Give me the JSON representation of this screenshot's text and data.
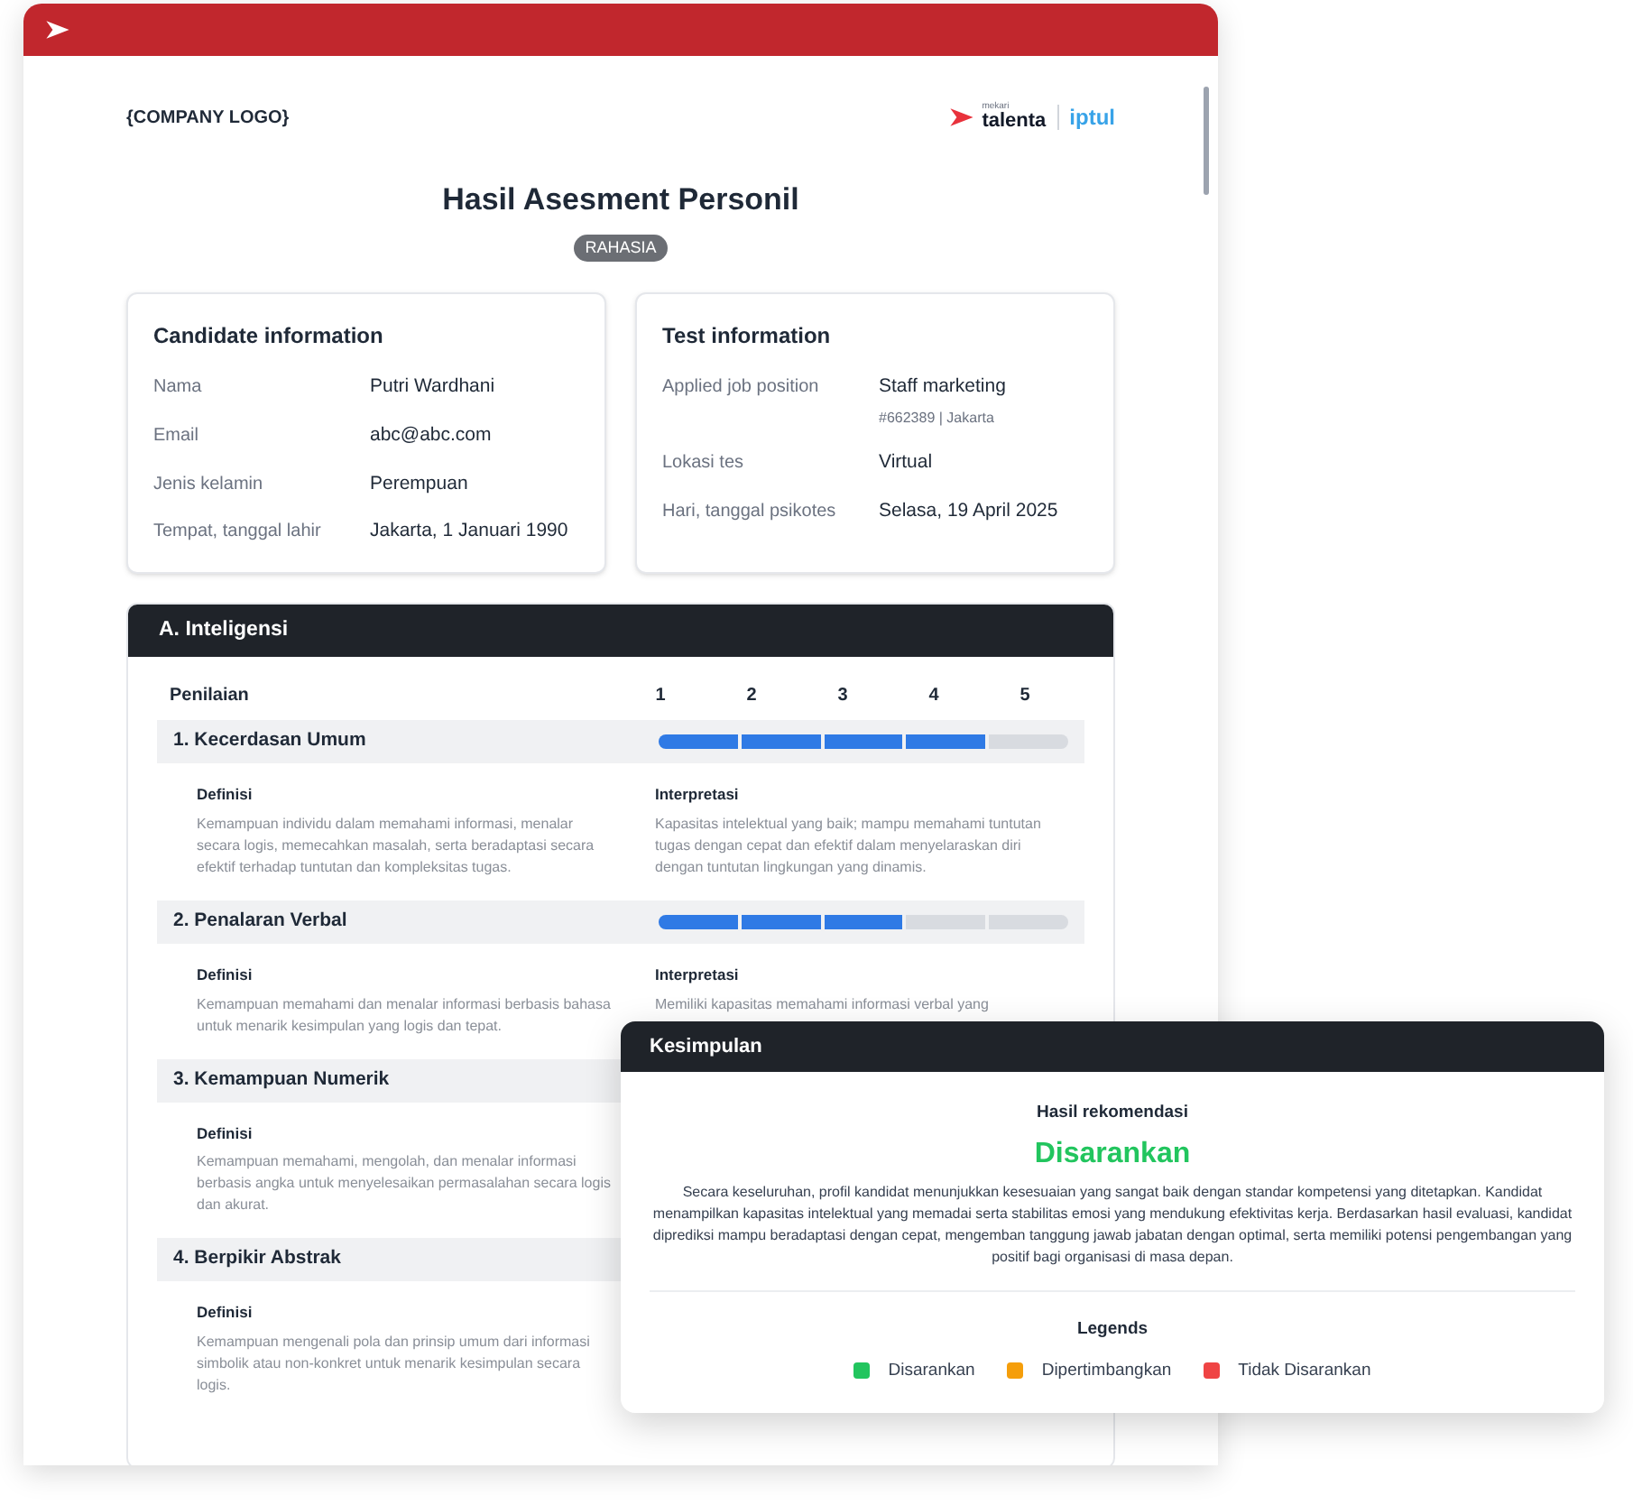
{
  "document": {
    "company_logo": "{COMPANY LOGO}",
    "brand_logo": {
      "name": "talenta",
      "tagline": "mekari",
      "partner": "iptul"
    },
    "title": "Hasil Asesment Personil",
    "badge": "RAHASIA",
    "candidate_info": {
      "title": "Candidate information",
      "rows": [
        {
          "label": "Nama",
          "value": "Putri Wardhani"
        },
        {
          "label": "Email",
          "value": "abc@abc.com"
        },
        {
          "label": "Jenis kelamin",
          "value": "Perempuan"
        },
        {
          "label": "Tempat, tanggal lahir",
          "value": "Jakarta, 1 Januari 1990"
        }
      ]
    },
    "test_info": {
      "title": "Test information",
      "rows": [
        {
          "label": "Applied job position",
          "value": "Staff marketing",
          "sub": "#662389 | Jakarta"
        },
        {
          "label": "Lokasi tes",
          "value": "Virtual"
        },
        {
          "label": "Hari, tanggal psikotes",
          "value": "Selasa, 19 April 2025"
        }
      ]
    },
    "section": {
      "title": "A. Inteligensi",
      "rating_label": "Penilaian",
      "scale": [
        "1",
        "2",
        "3",
        "4",
        "5"
      ],
      "items": [
        {
          "name": "1. Kecerdasan Umum",
          "level": 0.8,
          "definition_label": "Definisi",
          "definition": "Kemampuan individu dalam memahami informasi, menalar secara logis, memecahkan masalah, serta beradaptasi secara efektif terhadap tuntutan dan kompleksitas tugas.",
          "interpretation_label": "Interpretasi",
          "interpretation": "Kapasitas intelektual yang baik; mampu memahami tuntutan tugas dengan cepat dan efektif dalam menyelaraskan diri dengan tuntutan lingkungan yang dinamis."
        },
        {
          "name": "2. Penalaran Verbal",
          "level": 0.6,
          "definition_label": "Definisi",
          "definition": "Kemampuan memahami dan menalar informasi berbasis bahasa untuk menarik kesimpulan yang logis dan tepat.",
          "interpretation_label": "Interpretasi",
          "interpretation": "Memiliki kapasitas memahami informasi verbal yang"
        },
        {
          "name": "3. Kemampuan Numerik",
          "definition_label": "Definisi",
          "definition": "Kemampuan memahami, mengolah, dan menalar informasi berbasis angka untuk menyelesaikan permasalahan secara logis dan akurat."
        },
        {
          "name": "4. Berpikir Abstrak",
          "definition_label": "Definisi",
          "definition": "Kemampuan mengenali pola dan prinsip umum dari informasi simbolik atau non-konkret untuk menarik kesimpulan secara logis."
        }
      ]
    }
  },
  "conclusion": {
    "title": "Kesimpulan",
    "result_label": "Hasil rekomendasi",
    "result": "Disarankan",
    "summary": "Secara keseluruhan, profil kandidat menunjukkan kesesuaian yang sangat baik dengan standar kompetensi yang ditetapkan. Kandidat menampilkan kapasitas intelektual yang memadai serta stabilitas emosi yang mendukung efektivitas kerja. Berdasarkan hasil evaluasi, kandidat diprediksi mampu beradaptasi dengan cepat, mengemban tanggung jawab jabatan dengan optimal, serta memiliki potensi pengembangan yang positif bagi organisasi di masa depan.",
    "legends_title": "Legends",
    "legends": [
      {
        "label": "Disarankan",
        "color": "#22c55e"
      },
      {
        "label": "Dipertimbangkan",
        "color": "#f59e0b"
      },
      {
        "label": "Tidak Disarankan",
        "color": "#ef4444"
      }
    ]
  }
}
